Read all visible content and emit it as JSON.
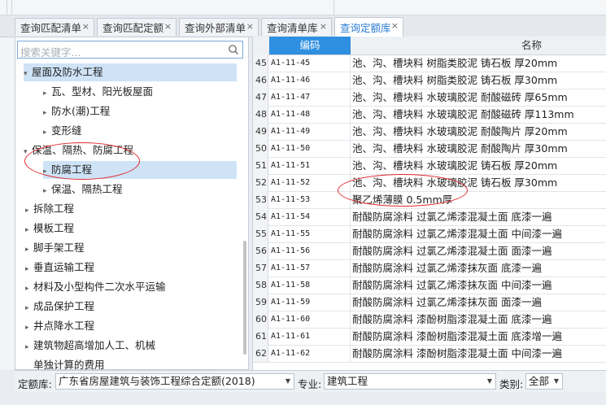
{
  "tabs": [
    {
      "label": "查询匹配清单",
      "close": "×"
    },
    {
      "label": "查询匹配定额",
      "close": "×"
    },
    {
      "label": "查询外部清单",
      "close": "×"
    },
    {
      "label": "查询清单库",
      "close": "×"
    },
    {
      "label": "查询定额库",
      "close": "×",
      "active": true
    }
  ],
  "search": {
    "placeholder": "搜索关键字..."
  },
  "tree": [
    {
      "label": "屋面及防水工程",
      "expanded": true,
      "selected": true
    },
    {
      "label": "瓦、型材、阳光板屋面",
      "expanded": false
    },
    {
      "label": "防水(潮)工程",
      "expanded": false
    },
    {
      "label": "变形缝",
      "expanded": false
    },
    {
      "label": "保温、隔热、防腐工程",
      "expanded": true
    },
    {
      "label": "防腐工程",
      "expanded": false,
      "selected": true
    },
    {
      "label": "保温、隔热工程",
      "expanded": false
    },
    {
      "label": "拆除工程",
      "expanded": false
    },
    {
      "label": "模板工程",
      "expanded": false
    },
    {
      "label": "脚手架工程",
      "expanded": false
    },
    {
      "label": "垂直运输工程",
      "expanded": false
    },
    {
      "label": "材料及小型构件二次水平运输",
      "expanded": false
    },
    {
      "label": "成品保护工程",
      "expanded": false
    },
    {
      "label": "井点降水工程",
      "expanded": false
    },
    {
      "label": "建筑物超高增加人工、机械",
      "expanded": false
    },
    {
      "label": "单独计算的费用",
      "expanded": false
    }
  ],
  "table": {
    "headers": {
      "code": "编码",
      "name": "名称"
    },
    "rows": [
      {
        "num": "45",
        "code": "A1-11-45",
        "name": "池、沟、槽块料 树脂类胶泥 铸石板 厚20mm"
      },
      {
        "num": "46",
        "code": "A1-11-46",
        "name": "池、沟、槽块料 树脂类胶泥 铸石板 厚30mm"
      },
      {
        "num": "47",
        "code": "A1-11-47",
        "name": "池、沟、槽块料 水玻璃胶泥 耐酸磁砖 厚65mm"
      },
      {
        "num": "48",
        "code": "A1-11-48",
        "name": "池、沟、槽块料 水玻璃胶泥 耐酸磁砖 厚113mm"
      },
      {
        "num": "49",
        "code": "A1-11-49",
        "name": "池、沟、槽块料 水玻璃胶泥 耐酸陶片 厚20mm"
      },
      {
        "num": "50",
        "code": "A1-11-50",
        "name": "池、沟、槽块料 水玻璃胶泥 耐酸陶片 厚30mm"
      },
      {
        "num": "51",
        "code": "A1-11-51",
        "name": "池、沟、槽块料 水玻璃胶泥 铸石板 厚20mm"
      },
      {
        "num": "52",
        "code": "A1-11-52",
        "name": "池、沟、槽块料 水玻璃胶泥 铸石板 厚30mm"
      },
      {
        "num": "53",
        "code": "A1-11-53",
        "name": "聚乙烯薄膜 0.5mm厚"
      },
      {
        "num": "54",
        "code": "A1-11-54",
        "name": "耐酸防腐涂料 过氯乙烯漆混凝土面 底漆一遍"
      },
      {
        "num": "55",
        "code": "A1-11-55",
        "name": "耐酸防腐涂料 过氯乙烯漆混凝土面 中间漆一遍"
      },
      {
        "num": "56",
        "code": "A1-11-56",
        "name": "耐酸防腐涂料 过氯乙烯漆混凝土面 面漆一遍"
      },
      {
        "num": "57",
        "code": "A1-11-57",
        "name": "耐酸防腐涂料 过氯乙烯漆抹灰面 底漆一遍"
      },
      {
        "num": "58",
        "code": "A1-11-58",
        "name": "耐酸防腐涂料 过氯乙烯漆抹灰面 中间漆一遍"
      },
      {
        "num": "59",
        "code": "A1-11-59",
        "name": "耐酸防腐涂料 过氯乙烯漆抹灰面 面漆一遍"
      },
      {
        "num": "60",
        "code": "A1-11-60",
        "name": "耐酸防腐涂料 漆酚树脂漆混凝土面 底漆一遍"
      },
      {
        "num": "61",
        "code": "A1-11-61",
        "name": "耐酸防腐涂料 漆酚树脂漆混凝土面 底漆增一遍"
      },
      {
        "num": "62",
        "code": "A1-11-62",
        "name": "耐酸防腐涂料 漆酚树脂漆混凝土面 中间漆一遍"
      }
    ]
  },
  "bottom": {
    "quota_label": "定额库:",
    "quota_value": "广东省房屋建筑与装饰工程综合定额(2018)",
    "major_label": "专业:",
    "major_value": "建筑工程",
    "category_label": "类别:",
    "category_value": "全部"
  },
  "colors": {
    "accent": "#2f8fe0",
    "annotation": "#e0282c",
    "selection": "#cfe3f7"
  }
}
